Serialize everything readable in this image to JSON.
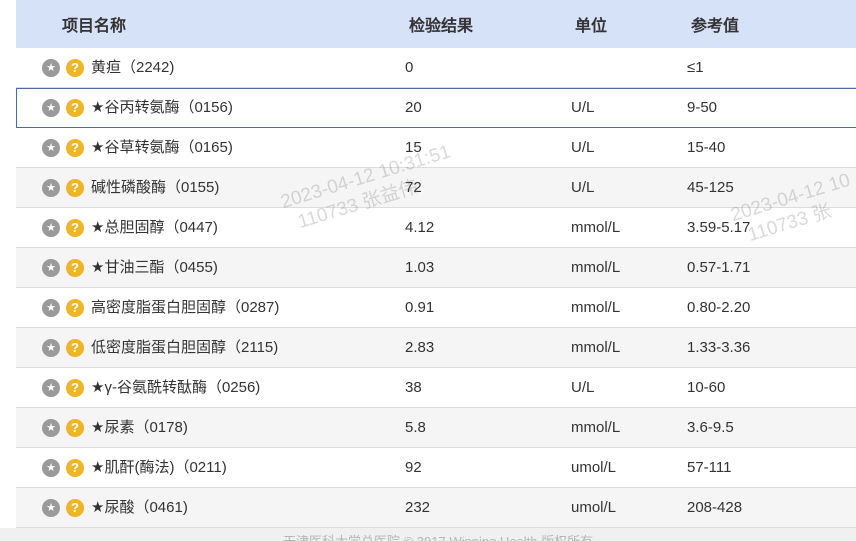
{
  "header": {
    "col_name": "项目名称",
    "col_result": "检验结果",
    "col_unit": "单位",
    "col_ref": "参考值"
  },
  "rows": [
    {
      "name": "黄疸（2242)",
      "result": "0",
      "unit": "",
      "ref": "≤1"
    },
    {
      "name": "★谷丙转氨酶（0156)",
      "result": "20",
      "unit": "U/L",
      "ref": "9-50"
    },
    {
      "name": "★谷草转氨酶（0165)",
      "result": "15",
      "unit": "U/L",
      "ref": "15-40"
    },
    {
      "name": "碱性磷酸酶（0155)",
      "result": "72",
      "unit": "U/L",
      "ref": "45-125"
    },
    {
      "name": "★总胆固醇（0447)",
      "result": "4.12",
      "unit": "mmol/L",
      "ref": "3.59-5.17"
    },
    {
      "name": "★甘油三酯（0455)",
      "result": "1.03",
      "unit": "mmol/L",
      "ref": "0.57-1.71"
    },
    {
      "name": "高密度脂蛋白胆固醇（0287)",
      "result": "0.91",
      "unit": "mmol/L",
      "ref": "0.80-2.20"
    },
    {
      "name": "低密度脂蛋白胆固醇（2115)",
      "result": "2.83",
      "unit": "mmol/L",
      "ref": "1.33-3.36"
    },
    {
      "name": "★γ-谷氨酰转酞酶（0256)",
      "result": "38",
      "unit": "U/L",
      "ref": "10-60"
    },
    {
      "name": "★尿素（0178)",
      "result": "5.8",
      "unit": "mmol/L",
      "ref": "3.6-9.5"
    },
    {
      "name": "★肌酐(酶法)（0211)",
      "result": "92",
      "unit": "umol/L",
      "ref": "57-111"
    },
    {
      "name": "★尿酸（0461)",
      "result": "232",
      "unit": "umol/L",
      "ref": "208-428"
    }
  ],
  "icons": {
    "favorite": "star-icon",
    "help": "question-icon"
  },
  "watermark": {
    "line1": "2023-04-12 10:31:51",
    "line2": "110733 张益伟",
    "line1_clipped": "2023-04-12 10",
    "line2_clipped": "110733 张"
  },
  "footer": {
    "text": "天津医科大学总医院    © 2017 Winning Health 版权所有"
  }
}
